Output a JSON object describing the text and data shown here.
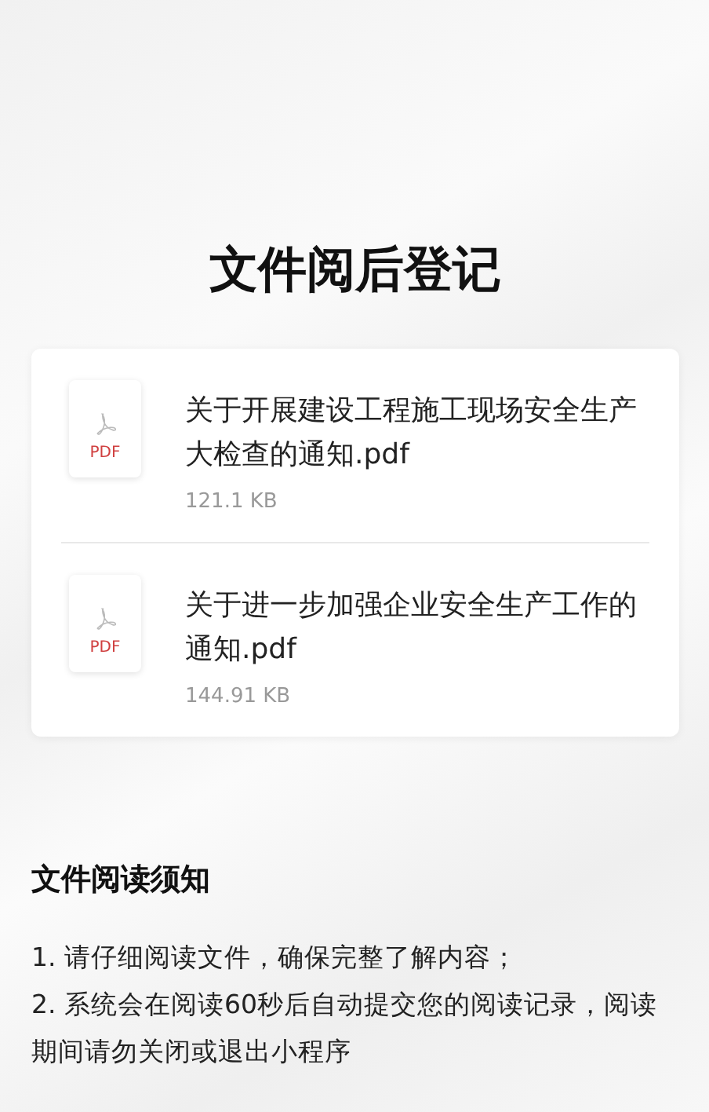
{
  "title": "文件阅后登记",
  "files": [
    {
      "name": "关于开展建设工程施工现场安全生产大检查的通知.pdf",
      "type_label": "PDF",
      "size": "121.1 KB"
    },
    {
      "name": "关于进一步加强企业安全生产工作的通知.pdf",
      "type_label": "PDF",
      "size": "144.91 KB"
    }
  ],
  "notice": {
    "heading": "文件阅读须知",
    "items": [
      "1. 请仔细阅读文件，确保完整了解内容；",
      "2. 系统会在阅读60秒后自动提交您的阅读记录，阅读期间请勿关闭或退出小程序"
    ]
  }
}
